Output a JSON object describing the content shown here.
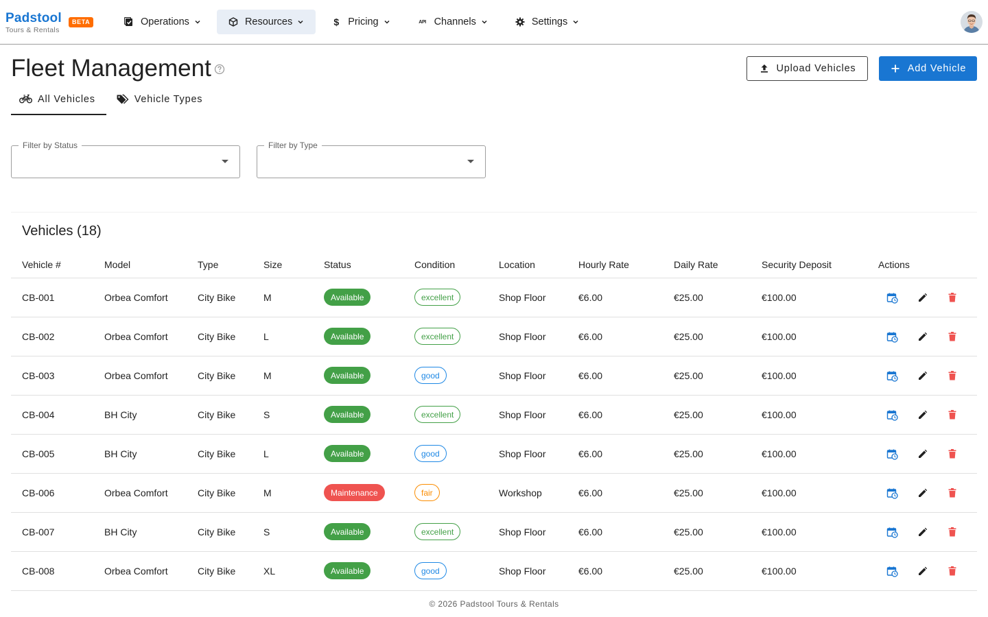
{
  "brand": {
    "name": "Padstool",
    "subtitle": "Tours & Rentals",
    "badge": "BETA",
    "color": "#1976d2",
    "badge_color": "#ff6d00"
  },
  "nav": [
    {
      "label": "Operations",
      "icon": "clipboard-check-icon",
      "active": false
    },
    {
      "label": "Resources",
      "icon": "cube-icon",
      "active": true
    },
    {
      "label": "Pricing",
      "icon": "dollar-icon",
      "active": false
    },
    {
      "label": "Channels",
      "icon": "api-icon",
      "active": false
    },
    {
      "label": "Settings",
      "icon": "gear-icon",
      "active": false
    }
  ],
  "header": {
    "title": "Fleet Management",
    "upload_label": "Upload Vehicles",
    "add_label": "Add Vehicle"
  },
  "tabs": [
    {
      "label": "All Vehicles",
      "icon": "bike-icon",
      "active": true
    },
    {
      "label": "Vehicle Types",
      "icon": "tags-icon",
      "active": false
    }
  ],
  "filters": {
    "status": {
      "label": "Filter by Status",
      "value": ""
    },
    "type": {
      "label": "Filter by Type",
      "value": ""
    }
  },
  "table": {
    "title": "Vehicles (18)",
    "columns": [
      "Vehicle #",
      "Model",
      "Type",
      "Size",
      "Status",
      "Condition",
      "Location",
      "Hourly Rate",
      "Daily Rate",
      "Security Deposit",
      "Actions"
    ],
    "rows": [
      {
        "id": "CB-001",
        "model": "Orbea Comfort",
        "type": "City Bike",
        "size": "M",
        "status": "Available",
        "condition": "excellent",
        "location": "Shop Floor",
        "hourly": "€6.00",
        "daily": "€25.00",
        "deposit": "€100.00"
      },
      {
        "id": "CB-002",
        "model": "Orbea Comfort",
        "type": "City Bike",
        "size": "L",
        "status": "Available",
        "condition": "excellent",
        "location": "Shop Floor",
        "hourly": "€6.00",
        "daily": "€25.00",
        "deposit": "€100.00"
      },
      {
        "id": "CB-003",
        "model": "Orbea Comfort",
        "type": "City Bike",
        "size": "M",
        "status": "Available",
        "condition": "good",
        "location": "Shop Floor",
        "hourly": "€6.00",
        "daily": "€25.00",
        "deposit": "€100.00"
      },
      {
        "id": "CB-004",
        "model": "BH City",
        "type": "City Bike",
        "size": "S",
        "status": "Available",
        "condition": "excellent",
        "location": "Shop Floor",
        "hourly": "€6.00",
        "daily": "€25.00",
        "deposit": "€100.00"
      },
      {
        "id": "CB-005",
        "model": "BH City",
        "type": "City Bike",
        "size": "L",
        "status": "Available",
        "condition": "good",
        "location": "Shop Floor",
        "hourly": "€6.00",
        "daily": "€25.00",
        "deposit": "€100.00"
      },
      {
        "id": "CB-006",
        "model": "Orbea Comfort",
        "type": "City Bike",
        "size": "M",
        "status": "Maintenance",
        "condition": "fair",
        "location": "Workshop",
        "hourly": "€6.00",
        "daily": "€25.00",
        "deposit": "€100.00"
      },
      {
        "id": "CB-007",
        "model": "BH City",
        "type": "City Bike",
        "size": "S",
        "status": "Available",
        "condition": "excellent",
        "location": "Shop Floor",
        "hourly": "€6.00",
        "daily": "€25.00",
        "deposit": "€100.00"
      },
      {
        "id": "CB-008",
        "model": "Orbea Comfort",
        "type": "City Bike",
        "size": "XL",
        "status": "Available",
        "condition": "good",
        "location": "Shop Floor",
        "hourly": "€6.00",
        "daily": "€25.00",
        "deposit": "€100.00"
      }
    ]
  },
  "colors": {
    "available": "#43a047",
    "maintenance": "#ef5350",
    "excellent": "#43a047",
    "good": "#1e88e5",
    "fair": "#fb8c00",
    "schedule_icon": "#1976d2",
    "edit_icon": "#212121",
    "delete_icon": "#ef5350"
  },
  "footer": "© 2026 Padstool Tours & Rentals"
}
